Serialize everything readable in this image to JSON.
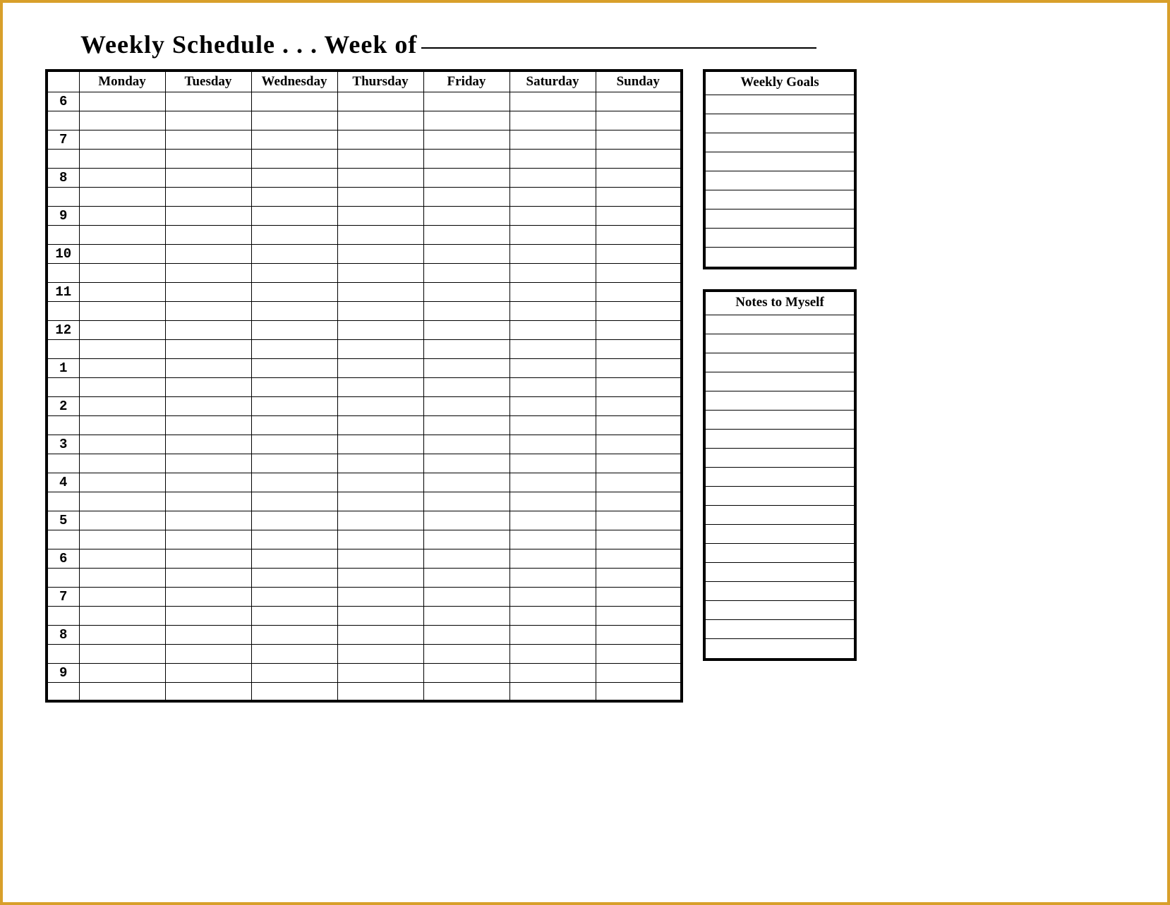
{
  "title": {
    "prefix": "Weekly Schedule . . . Week of",
    "value": ""
  },
  "schedule": {
    "days": [
      "Monday",
      "Tuesday",
      "Wednesday",
      "Thursday",
      "Friday",
      "Saturday",
      "Sunday"
    ],
    "hours": [
      "6",
      "7",
      "8",
      "9",
      "10",
      "11",
      "12",
      "1",
      "2",
      "3",
      "4",
      "5",
      "6",
      "7",
      "8",
      "9"
    ]
  },
  "goals": {
    "header": "Weekly Goals",
    "lines": 9
  },
  "notes": {
    "header": "Notes to Myself",
    "lines": 18
  }
}
